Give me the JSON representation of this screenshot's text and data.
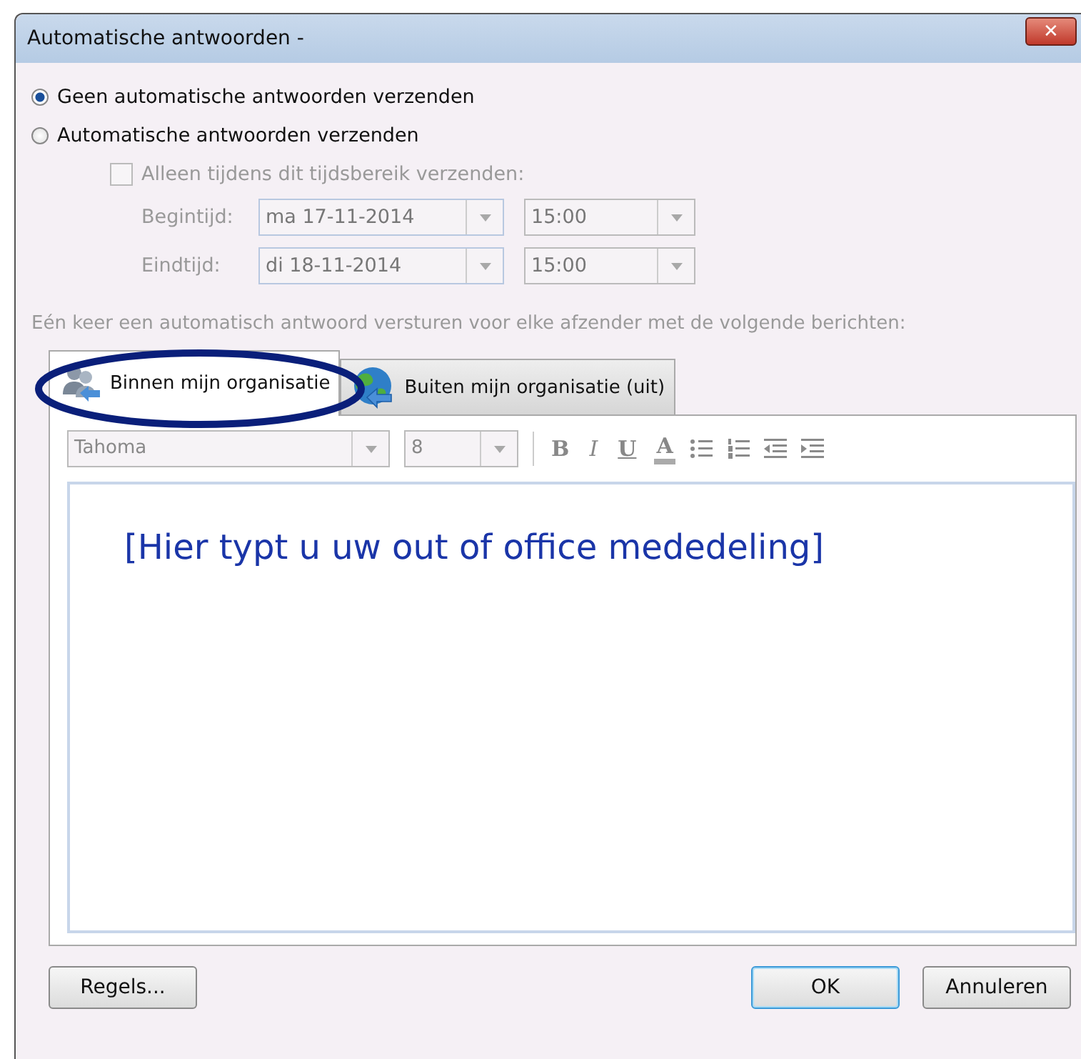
{
  "window": {
    "title": "Automatische antwoorden -",
    "close": "✕"
  },
  "options": [
    {
      "label": "Geen automatische antwoorden verzenden",
      "selected": true
    },
    {
      "label": "Automatische antwoorden verzenden",
      "selected": false
    }
  ],
  "time_range": {
    "label": "Alleen tijdens dit tijdsbereik verzenden:",
    "checked": false,
    "disabled": true,
    "rows": [
      {
        "label": "Begintijd:",
        "date": "ma 17-11-2014",
        "time": "15:00"
      },
      {
        "label": "Eindtijd:",
        "date": "di 18-11-2014",
        "time": "15:00"
      }
    ]
  },
  "note": "Eén keer een automatisch antwoord versturen voor elke afzender met de volgende berichten:",
  "tabs": [
    {
      "label": "Binnen mijn organisatie",
      "selected": true,
      "kind": "people",
      "circled": true
    },
    {
      "label": "Buiten mijn organisatie (uit)",
      "selected": false,
      "kind": "globe",
      "circled": false
    }
  ],
  "toolbar": {
    "font": "Tahoma",
    "size": "8",
    "format_buttons": [
      {
        "kind": "bold",
        "label": "B"
      },
      {
        "kind": "italic",
        "label": "I"
      },
      {
        "kind": "underline",
        "label": "U"
      },
      {
        "kind": "color",
        "label": "A"
      }
    ],
    "list_buttons": [
      {
        "kind": "bullets"
      },
      {
        "kind": "numbering"
      },
      {
        "kind": "outdent"
      },
      {
        "kind": "indent"
      }
    ]
  },
  "editor": {
    "value": "[Hier typt u uw out of office mededeling]"
  },
  "buttons": [
    {
      "label": "Regels...",
      "kind": "left"
    },
    {
      "label": "OK",
      "kind": "default"
    },
    {
      "label": "Annuleren",
      "kind": "normal"
    }
  ]
}
